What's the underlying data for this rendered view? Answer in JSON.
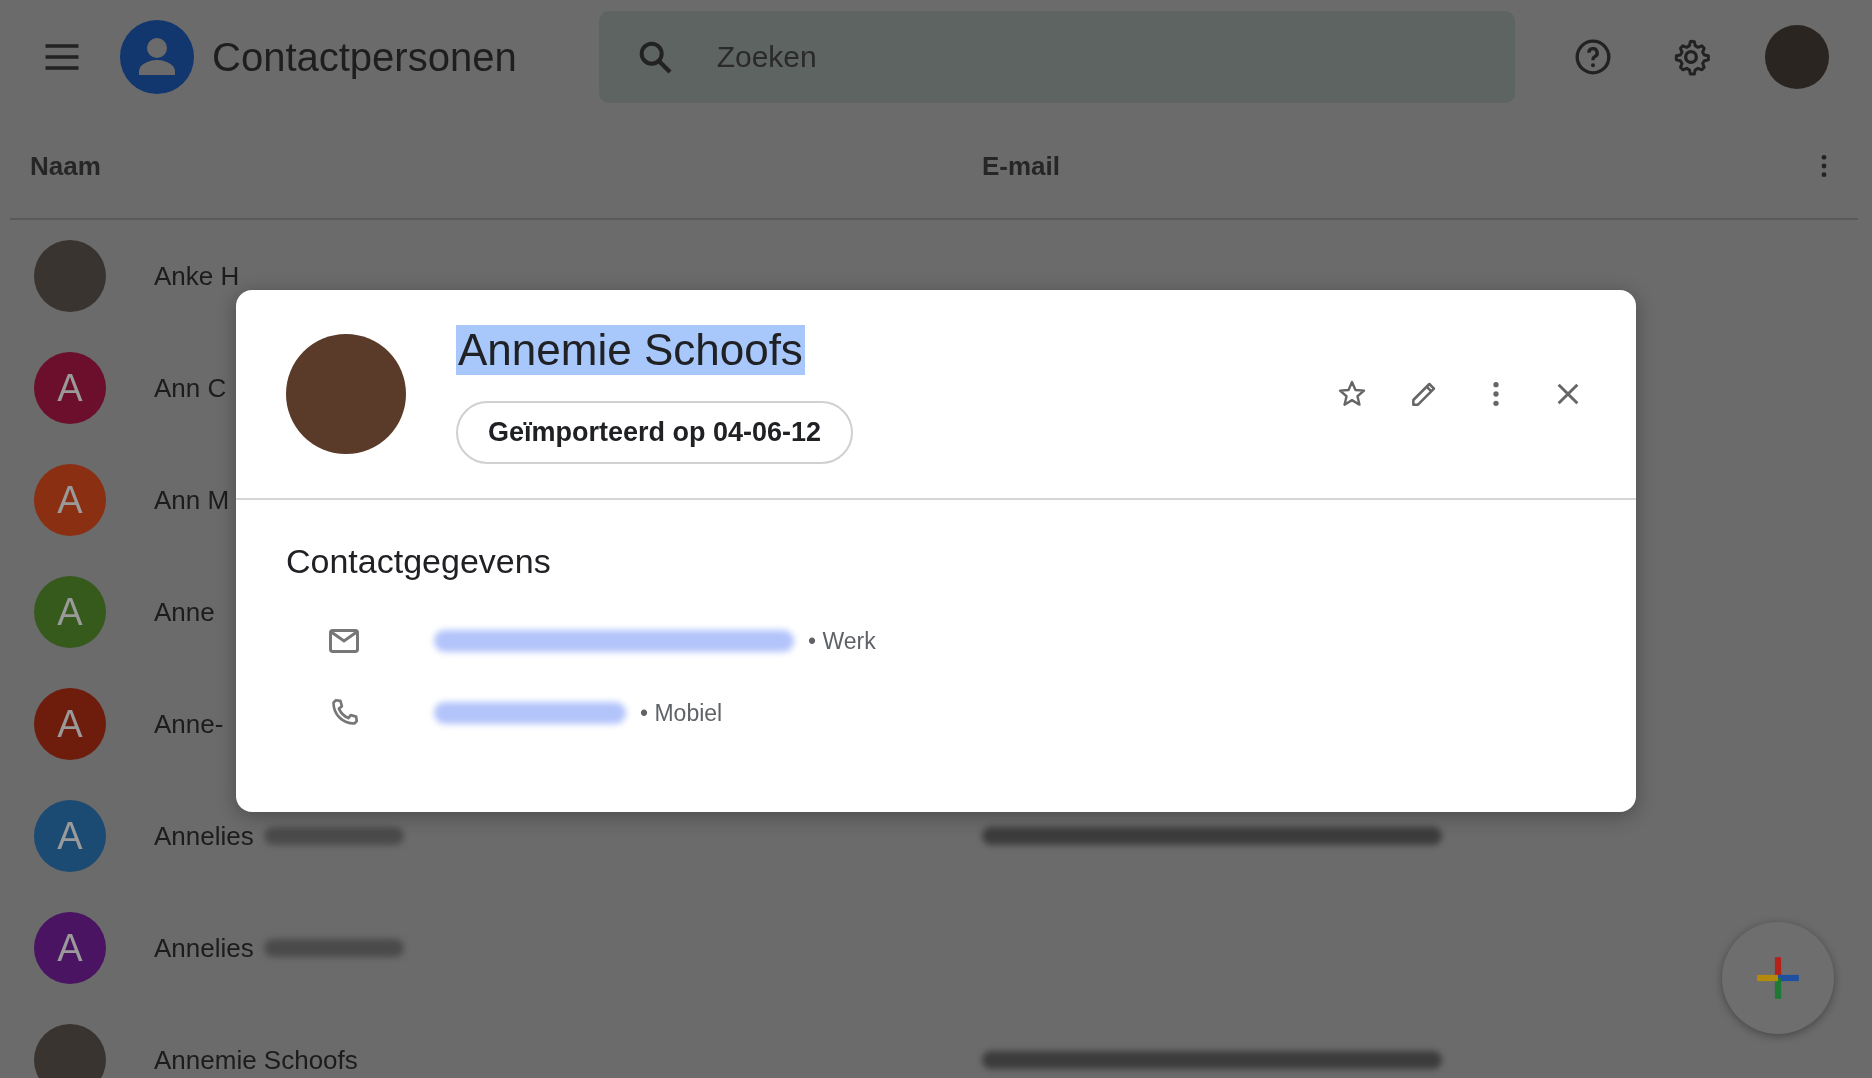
{
  "header": {
    "title": "Contactpersonen",
    "search": {
      "placeholder": "Zoeken"
    }
  },
  "table": {
    "columns": [
      "Naam",
      "E-mail"
    ],
    "rows": [
      {
        "avatar": {
          "kind": "photo"
        },
        "name": "Anke H",
        "surname_blurred": false,
        "email_blurred": false
      },
      {
        "avatar": {
          "kind": "letter",
          "letter": "A",
          "color": "#6b0f2c"
        },
        "name": "Ann C",
        "surname_blurred": false,
        "email_blurred": false
      },
      {
        "avatar": {
          "kind": "letter",
          "letter": "A",
          "color": "#8a2f12"
        },
        "name": "Ann M",
        "surname_blurred": false,
        "email_blurred": false
      },
      {
        "avatar": {
          "kind": "letter",
          "letter": "A",
          "color": "#355a1b"
        },
        "name": "Anne",
        "surname_blurred": false,
        "email_blurred": false
      },
      {
        "avatar": {
          "kind": "letter",
          "letter": "A",
          "color": "#6e1d0c"
        },
        "name": "Anne-",
        "surname_blurred": false,
        "email_blurred": false
      },
      {
        "avatar": {
          "kind": "letter",
          "letter": "A",
          "color": "#1b4a72"
        },
        "name": "Annelies",
        "surname_blurred": true,
        "email_blurred": true
      },
      {
        "avatar": {
          "kind": "letter",
          "letter": "A",
          "color": "#4a1463"
        },
        "name": "Annelies",
        "surname_blurred": true,
        "email_blurred": false
      },
      {
        "avatar": {
          "kind": "photo"
        },
        "name": "Annemie Schoofs",
        "surname_blurred": false,
        "email_blurred": true
      }
    ]
  },
  "dialog": {
    "name": "Annemie Schoofs",
    "name_selected": true,
    "chip": "Geïmporteerd op 04-06-12",
    "section_title": "Contactgegevens",
    "details": [
      {
        "kind": "email",
        "label": "• Werk"
      },
      {
        "kind": "phone",
        "label": "• Mobiel"
      }
    ]
  }
}
